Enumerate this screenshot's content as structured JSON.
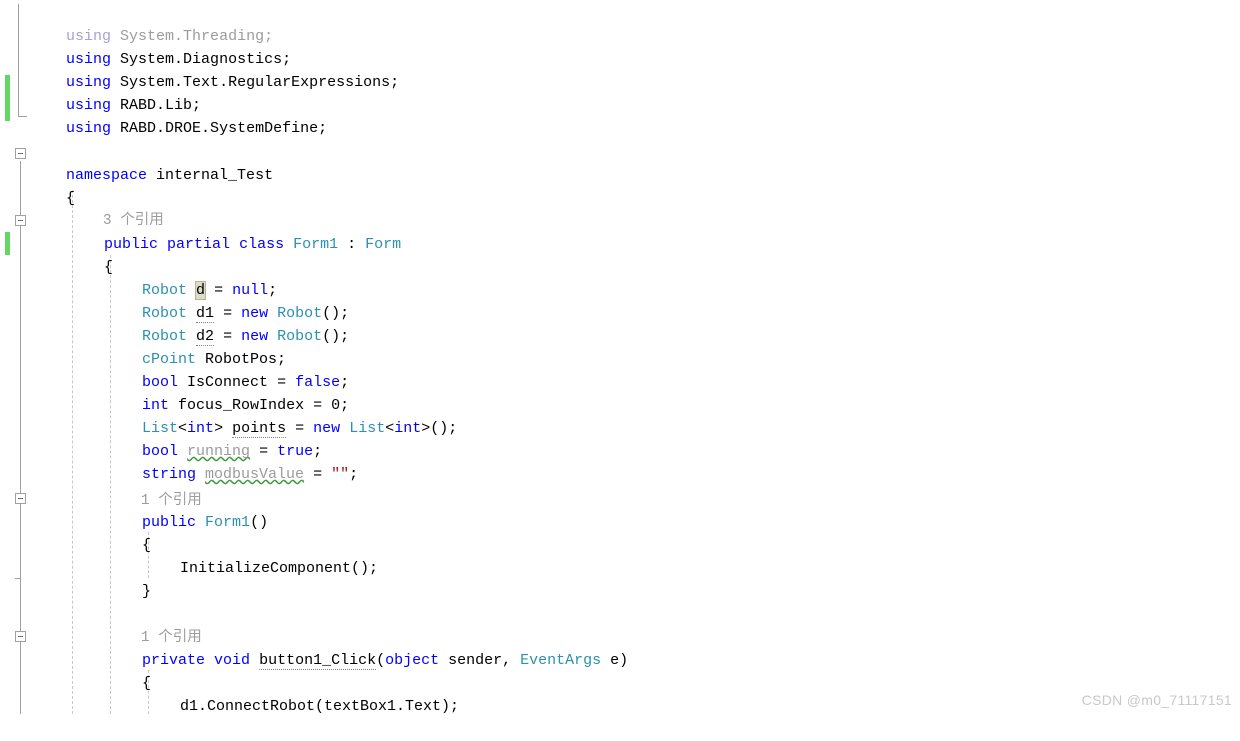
{
  "editor": {
    "language": "csharp",
    "theme": "visual-studio-light",
    "background": "#ffffff",
    "colors": {
      "keyword": "#0000FF",
      "type": "#2B91AF",
      "string": "#A31515",
      "comment_gray": "#9C9C9C",
      "codelens": "#9C9C9C",
      "change_bar_green": "#62D862",
      "indent_guide": "#C8C8C8",
      "outline_line": "#A0A0A0",
      "selection_highlight": "#DCDCC8",
      "warning_squiggle": "#3C9A3C",
      "watermark": "#C8C8C8"
    }
  },
  "watermark": {
    "text": "CSDN @m0_71117151"
  },
  "codelens": {
    "class_refs": "3 个引用",
    "ctor_refs": "1 个引用",
    "method_refs": "1 个引用"
  },
  "code": {
    "lines": [
      {
        "n": 1,
        "indent": 0,
        "text": "using System.Threading;",
        "state": "unused"
      },
      {
        "n": 2,
        "indent": 0,
        "text": "using System.Diagnostics;",
        "state": "normal"
      },
      {
        "n": 3,
        "indent": 0,
        "text": "using System.Text.RegularExpressions;",
        "state": "normal"
      },
      {
        "n": 4,
        "indent": 0,
        "text": "using RABD.Lib;",
        "state": "changed"
      },
      {
        "n": 5,
        "indent": 0,
        "text": "using RABD.DROE.SystemDefine;",
        "state": "changed"
      },
      {
        "n": 6,
        "indent": 0,
        "text": "",
        "state": "normal"
      },
      {
        "n": 7,
        "indent": 0,
        "text": "namespace internal_Test",
        "state": "normal"
      },
      {
        "n": 8,
        "indent": 0,
        "text": "{",
        "state": "normal"
      },
      {
        "n": 9,
        "indent": 1,
        "text": "3 个引用",
        "state": "codelens"
      },
      {
        "n": 10,
        "indent": 1,
        "text": "public partial class Form1 : Form",
        "state": "normal"
      },
      {
        "n": 11,
        "indent": 1,
        "text": "{",
        "state": "changed"
      },
      {
        "n": 12,
        "indent": 2,
        "text": "Robot d = null;",
        "state": "normal"
      },
      {
        "n": 13,
        "indent": 2,
        "text": "Robot d1 = new Robot();",
        "state": "normal"
      },
      {
        "n": 14,
        "indent": 2,
        "text": "Robot d2 = new Robot();",
        "state": "normal"
      },
      {
        "n": 15,
        "indent": 2,
        "text": "cPoint RobotPos;",
        "state": "normal"
      },
      {
        "n": 16,
        "indent": 2,
        "text": "bool IsConnect = false;",
        "state": "normal"
      },
      {
        "n": 17,
        "indent": 2,
        "text": "int focus_RowIndex = 0;",
        "state": "normal"
      },
      {
        "n": 18,
        "indent": 2,
        "text": "List<int> points = new List<int>();",
        "state": "normal"
      },
      {
        "n": 19,
        "indent": 2,
        "text": "bool running = true;",
        "state": "warning"
      },
      {
        "n": 20,
        "indent": 2,
        "text": "string modbusValue = \"\";",
        "state": "warning"
      },
      {
        "n": 21,
        "indent": 2,
        "text": "1 个引用",
        "state": "codelens"
      },
      {
        "n": 22,
        "indent": 2,
        "text": "public Form1()",
        "state": "normal"
      },
      {
        "n": 23,
        "indent": 2,
        "text": "{",
        "state": "normal"
      },
      {
        "n": 24,
        "indent": 3,
        "text": "InitializeComponent();",
        "state": "normal"
      },
      {
        "n": 25,
        "indent": 2,
        "text": "}",
        "state": "normal"
      },
      {
        "n": 26,
        "indent": 2,
        "text": "",
        "state": "normal"
      },
      {
        "n": 27,
        "indent": 2,
        "text": "1 个引用",
        "state": "codelens"
      },
      {
        "n": 28,
        "indent": 2,
        "text": "private void button1_Click(object sender, EventArgs e)",
        "state": "normal"
      },
      {
        "n": 29,
        "indent": 2,
        "text": "{",
        "state": "normal"
      },
      {
        "n": 30,
        "indent": 3,
        "text": "d1.ConnectRobot(textBox1.Text);",
        "state": "normal"
      }
    ]
  },
  "tokens": {
    "l1": {
      "kw": "using",
      "ns": "System.Threading;"
    },
    "l2": {
      "kw": "using",
      "ns": "System.Diagnostics;"
    },
    "l3": {
      "kw": "using",
      "ns": "System.Text.RegularExpressions;"
    },
    "l4": {
      "kw": "using",
      "ns": "RABD.Lib;"
    },
    "l5": {
      "kw": "using",
      "ns": "RABD.DROE.SystemDefine;"
    },
    "l7": {
      "kw": "namespace",
      "name": "internal_Test"
    },
    "l8": {
      "brace": "{"
    },
    "l10": {
      "k1": "public",
      "k2": "partial",
      "k3": "class",
      "t1": "Form1",
      "colon": ":",
      "t2": "Form"
    },
    "l11": {
      "brace": "{"
    },
    "l12": {
      "t": "Robot",
      "var": "d",
      "eq": "=",
      "kw": "null",
      "semi": ";"
    },
    "l13": {
      "t": "Robot",
      "var": "d1",
      "eq": "=",
      "knew": "new",
      "t2": "Robot",
      "tail": "();"
    },
    "l14": {
      "t": "Robot",
      "var": "d2",
      "eq": "=",
      "knew": "new",
      "t2": "Robot",
      "tail": "();"
    },
    "l15": {
      "t": "cPoint",
      "var": "RobotPos;"
    },
    "l16": {
      "t": "bool",
      "var": "IsConnect",
      "eq": "=",
      "kw": "false",
      "semi": ";"
    },
    "l17": {
      "t": "int",
      "var": "focus_RowIndex",
      "eq": "=",
      "val": "0",
      "semi": ";"
    },
    "l18": {
      "t": "List",
      "lt": "<",
      "t2": "int",
      "gt": ">",
      "var": "points",
      "eq": "=",
      "knew": "new",
      "t3": "List",
      "lt2": "<",
      "t4": "int",
      "gt2": ">",
      "tail": "();"
    },
    "l19": {
      "t": "bool",
      "var": "running",
      "eq": "=",
      "kw": "true",
      "semi": ";"
    },
    "l20": {
      "t": "string",
      "var": "modbusValue",
      "eq": "=",
      "str": "\"\"",
      "semi": ";"
    },
    "l22": {
      "k1": "public",
      "t": "Form1",
      "tail": "()"
    },
    "l23": {
      "brace": "{"
    },
    "l24": {
      "call": "InitializeComponent();"
    },
    "l25": {
      "brace": "}"
    },
    "l28": {
      "k1": "private",
      "k2": "void",
      "name": "button1_Click",
      "p1": "(",
      "k3": "object",
      "a1": " sender, ",
      "t1": "EventArgs",
      "a2": " e)"
    },
    "l29": {
      "brace": "{"
    },
    "l30": {
      "call": "d1.ConnectRobot(textBox1.Text);"
    }
  }
}
